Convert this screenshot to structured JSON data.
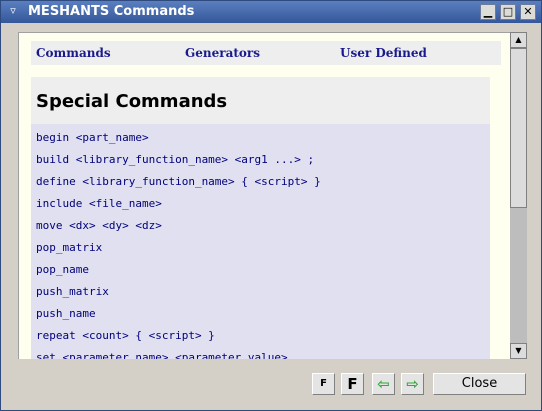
{
  "window": {
    "title": "MESHANTS Commands",
    "buttons": {
      "minimize": "▁",
      "maximize": "□",
      "close": "✕"
    }
  },
  "nav": {
    "commands": "Commands",
    "generators": "Generators",
    "user_defined": "User Defined"
  },
  "section": {
    "heading": "Special Commands",
    "commands": [
      "begin <part_name>",
      "build <library_function_name> <arg1 ...> ;",
      "define <library_function_name> { <script> }",
      "include <file_name>",
      "move <dx> <dy> <dz>",
      "pop_matrix",
      "pop_name",
      "push_matrix",
      "push_name",
      "repeat <count> { <script> }",
      "set <parameter_name> <parameter_value>"
    ]
  },
  "toolbar": {
    "font_small": "F",
    "font_large": "F",
    "back_icon": "⇦",
    "forward_icon": "⇨",
    "close_label": "Close"
  },
  "colors": {
    "title_bar": "#4468ad",
    "link": "#1a1a8c",
    "command_text": "#00007a",
    "section_bg": "#e0e0f0",
    "content_bg": "#fffff0",
    "arrow_green": "#36a836"
  }
}
